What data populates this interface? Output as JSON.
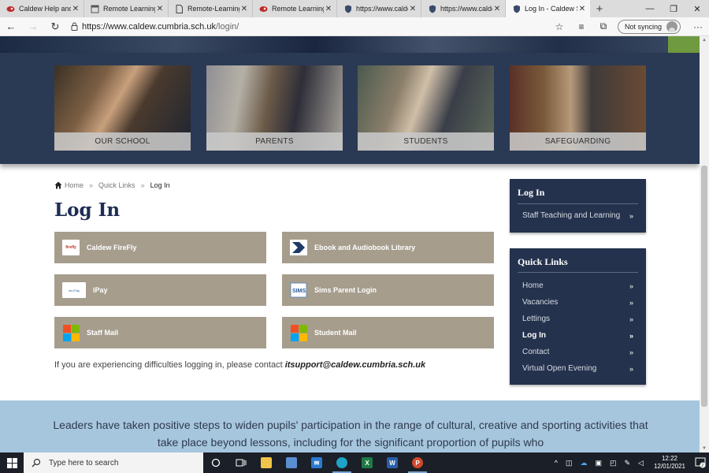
{
  "browser": {
    "tabs": [
      {
        "label": "Caldew Help and Advice",
        "icon": "firefly-icon"
      },
      {
        "label": "Remote Learning at Caldew",
        "icon": "page-icon"
      },
      {
        "label": "Remote-Learning",
        "icon": "document-icon"
      },
      {
        "label": "Remote Learning",
        "icon": "firefly-icon"
      },
      {
        "label": "https://www.caldew",
        "icon": "shield-icon"
      },
      {
        "label": "https://www.caldew",
        "icon": "shield-icon"
      },
      {
        "label": "Log In - Caldew School",
        "icon": "shield-icon",
        "active": true
      }
    ],
    "url_host": "https://www.caldew.cumbria.sch.uk",
    "url_path": "/login/",
    "sync_label": "Not syncing"
  },
  "tiles": [
    {
      "label": "OUR SCHOOL"
    },
    {
      "label": "PARENTS"
    },
    {
      "label": "STUDENTS"
    },
    {
      "label": "SAFEGUARDING"
    }
  ],
  "breadcrumb": {
    "home": "Home",
    "quick_links": "Quick Links",
    "current": "Log In"
  },
  "page_title": "Log In",
  "login_buttons": {
    "firefly": {
      "label": "Caldew FireFly",
      "logo": "firefly"
    },
    "ebook": {
      "label": "Ebook and Audiobook Library"
    },
    "ipay": {
      "label": "iPay",
      "logo": "my iPay"
    },
    "sims": {
      "label": "Sims Parent Login",
      "logo": "SIMS"
    },
    "staff_mail": {
      "label": "Staff Mail"
    },
    "student_mail": {
      "label": "Student Mail"
    }
  },
  "help": {
    "prefix": "If you are experiencing difficulties logging in, please contact ",
    "email": "itsupport@caldew.cumbria.sch.uk"
  },
  "sidebar": {
    "login_title": "Log In",
    "login_items": [
      "Staff Teaching and Learning"
    ],
    "quick_title": "Quick Links",
    "quick_items": [
      "Home",
      "Vacancies",
      "Lettings",
      "Log In",
      "Contact",
      "Virtual Open Evening"
    ],
    "quick_active": "Log In"
  },
  "quote": {
    "text": "Leaders have taken positive steps to widen pupils' participation in the range of cultural, creative and sporting activities that take place beyond lessons, including for the significant proportion of pupils who"
  },
  "taskbar": {
    "search_placeholder": "Type here to search",
    "time": "12:22",
    "date": "12/01/2021",
    "notification_count": "2"
  },
  "colors": {
    "navy": "#24324d",
    "title": "#1e2d54",
    "button": "#a69d8d",
    "quote_bg": "#a6c6dd"
  }
}
